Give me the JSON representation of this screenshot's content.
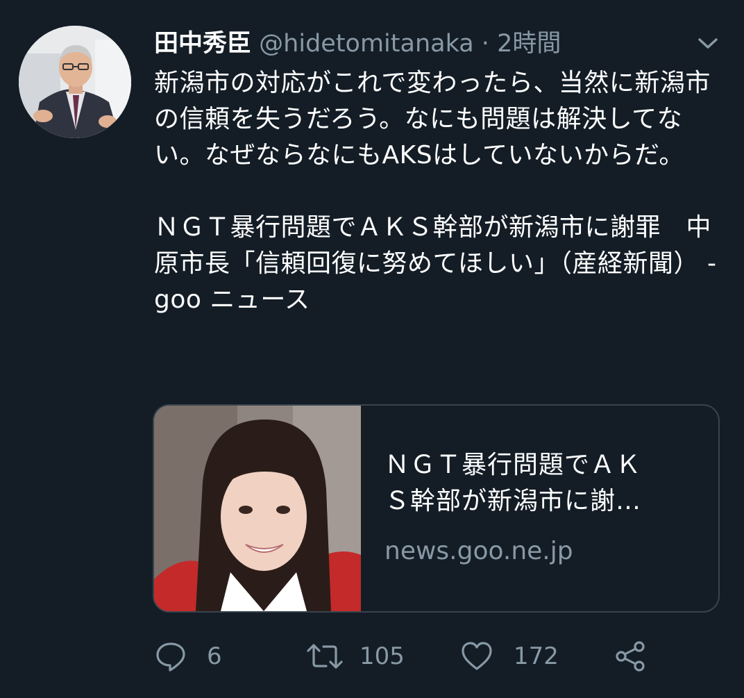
{
  "tweet": {
    "display_name": "田中秀臣",
    "handle": "@hidetomitanaka",
    "separator": " · ",
    "time": "2時間",
    "text": "新潟市の対応がこれで変わったら、当然に新潟市の信頼を失うだろう。なにも問題は解決してない。なぜならなにもAKSはしていないからだ。\n\nＮＧＴ暴行問題でＡＫＳ幹部が新潟市に謝罪　中原市長「信頼回復に努めてほしい」（産経新聞） - goo ニュース"
  },
  "card": {
    "title": "ＮＧＴ暴行問題でＡＫ\nＳ幹部が新潟市に謝…",
    "domain": "news.goo.ne.jp"
  },
  "actions": {
    "reply_count": "6",
    "retweet_count": "105",
    "like_count": "172"
  },
  "icons": {
    "avatar": "profile-photo",
    "menu": "chevron-down-icon",
    "reply": "reply-icon",
    "retweet": "retweet-icon",
    "like": "heart-icon",
    "share": "share-icon"
  },
  "colors": {
    "background": "#141d26",
    "text": "#ffffff",
    "secondary": "#8899a6",
    "card_border": "#38444d"
  }
}
